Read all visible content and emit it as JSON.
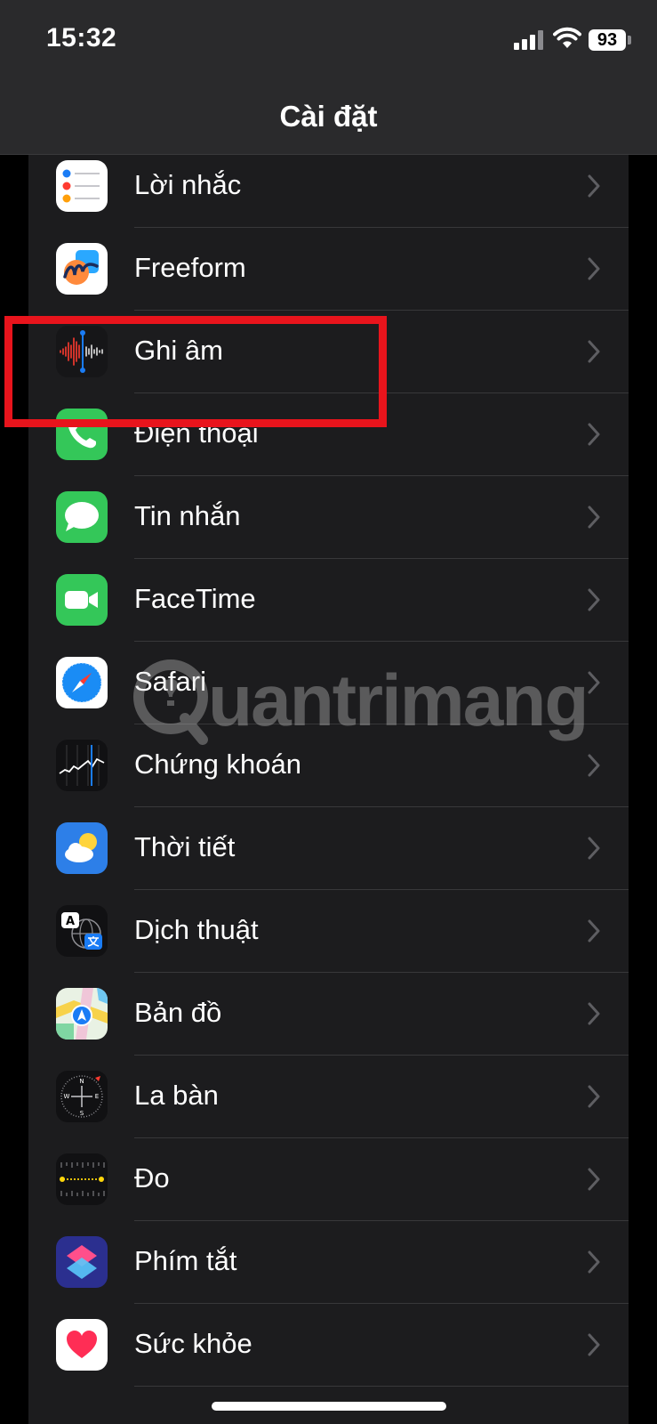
{
  "status_bar": {
    "time": "15:32",
    "battery": "93"
  },
  "nav": {
    "title": "Cài đặt"
  },
  "watermark": "uantrimang",
  "settings_items": [
    {
      "label": "Lời nhắc",
      "icon": "reminders-icon"
    },
    {
      "label": "Freeform",
      "icon": "freeform-icon"
    },
    {
      "label": "Ghi âm",
      "icon": "voice-memos-icon"
    },
    {
      "label": "Điện thoại",
      "icon": "phone-icon"
    },
    {
      "label": "Tin nhắn",
      "icon": "messages-icon"
    },
    {
      "label": "FaceTime",
      "icon": "facetime-icon"
    },
    {
      "label": "Safari",
      "icon": "safari-icon"
    },
    {
      "label": "Chứng khoán",
      "icon": "stocks-icon"
    },
    {
      "label": "Thời tiết",
      "icon": "weather-icon"
    },
    {
      "label": "Dịch thuật",
      "icon": "translate-icon"
    },
    {
      "label": "Bản đồ",
      "icon": "maps-icon"
    },
    {
      "label": "La bàn",
      "icon": "compass-icon"
    },
    {
      "label": "Đo",
      "icon": "measure-icon"
    },
    {
      "label": "Phím tắt",
      "icon": "shortcuts-icon"
    },
    {
      "label": "Sức khỏe",
      "icon": "health-icon"
    }
  ],
  "colors": {
    "highlight": "#e8141c",
    "row_bg": "#1c1c1e",
    "header_bg": "#2a2a2c"
  }
}
